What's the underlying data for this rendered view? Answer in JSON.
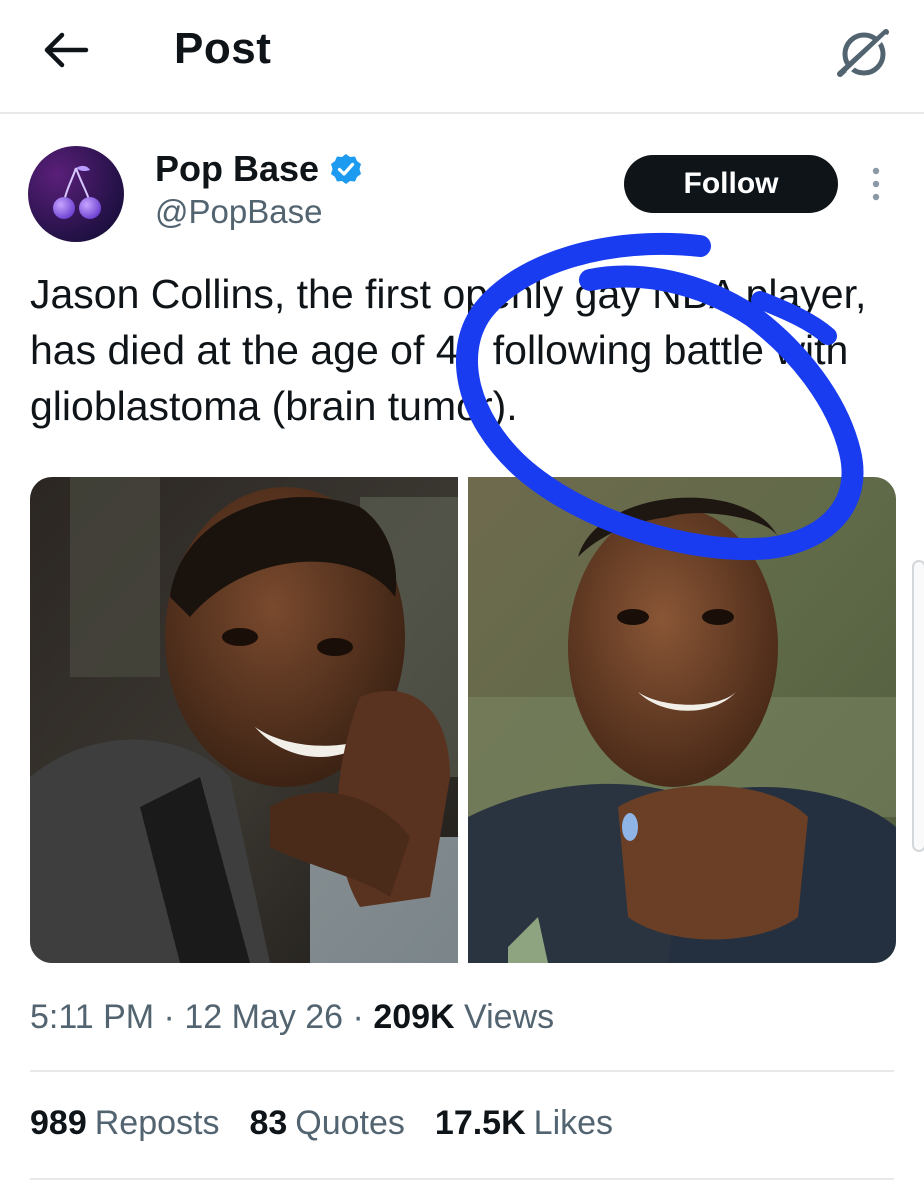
{
  "header": {
    "title": "Post",
    "back_icon": "arrow-left-icon",
    "grok_icon": "grok-icon"
  },
  "author": {
    "display_name": "Pop Base",
    "handle": "@PopBase",
    "verified": true,
    "avatar_icon": "cherries-icon",
    "follow_label": "Follow",
    "more_icon": "more-vertical-icon"
  },
  "post": {
    "text": "Jason Collins, the first openly gay NBA player, has died at the age of 47 following battle with glioblastoma (brain tumor).",
    "images": [
      {
        "subject": "portrait-left"
      },
      {
        "subject": "portrait-right"
      }
    ],
    "time": "5:11 PM",
    "separator": " · ",
    "date": "12 May 26",
    "views_count": "209K",
    "views_label": " Views"
  },
  "stats": {
    "reposts_count": "989",
    "reposts_label": "Reposts",
    "quotes_count": "83",
    "quotes_label": "Quotes",
    "likes_count": "17.5K",
    "likes_label": "Likes"
  },
  "colors": {
    "text": "#0f1419",
    "secondary": "#536471",
    "verified": "#1d9bf0",
    "annotation": "#1a3cf0",
    "divider": "#e6e8ea"
  }
}
